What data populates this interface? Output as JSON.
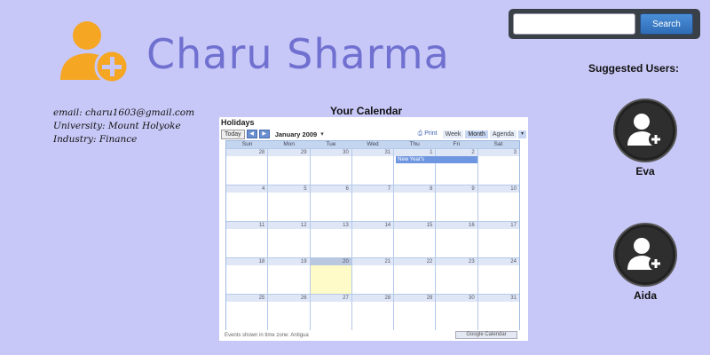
{
  "header": {
    "name": "Charu Sharma",
    "logo_icon": "add-user-icon"
  },
  "search": {
    "placeholder": "",
    "value": "",
    "button_label": "Search"
  },
  "profile": {
    "email": "email: charu1603@gmail.com",
    "university": "University: Mount Holyoke",
    "industry": "Industry: Finance"
  },
  "calendar": {
    "heading": "Your Calendar",
    "name": "Holidays",
    "today_label": "Today",
    "prev_label": "◀",
    "next_label": "▶",
    "month_label": "January 2009",
    "caret": "▾",
    "print_label": "Print",
    "views": [
      "Week",
      "Month",
      "Agenda"
    ],
    "active_view": "Month",
    "days_of_week": [
      "Sun",
      "Mon",
      "Tue",
      "Wed",
      "Thu",
      "Fri",
      "Sat"
    ],
    "weeks": [
      [
        "28",
        "29",
        "30",
        "31",
        "1",
        "2",
        "3"
      ],
      [
        "4",
        "5",
        "6",
        "7",
        "8",
        "9",
        "10"
      ],
      [
        "11",
        "12",
        "13",
        "14",
        "15",
        "16",
        "17"
      ],
      [
        "18",
        "19",
        "20",
        "21",
        "22",
        "23",
        "24"
      ],
      [
        "25",
        "26",
        "27",
        "28",
        "29",
        "30",
        "31"
      ]
    ],
    "today_date": "20",
    "event": "New Year's",
    "footer": "Events shown in time zone: Antigua",
    "google_button": "Google Calendar"
  },
  "suggested": {
    "title": "Suggested Users:",
    "users": [
      {
        "name": "Eva",
        "icon": "add-user-icon"
      },
      {
        "name": "Aida",
        "icon": "add-user-icon"
      }
    ]
  },
  "colors": {
    "background": "#c8c8f8",
    "title": "#7070d0",
    "logo": "#f5a623",
    "search_button": "#3a7bc8"
  }
}
